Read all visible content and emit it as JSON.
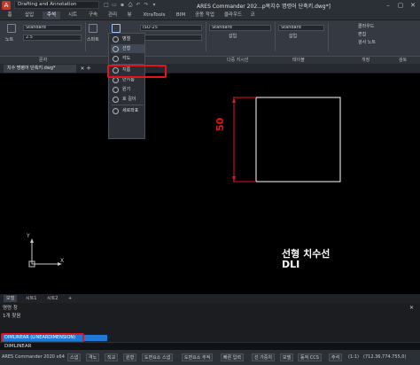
{
  "app": {
    "workspace": "Drafting and Annotation",
    "window_title": "ARES Commander 202...p복치수 명령어 단축키.dwg*]"
  },
  "ribbon_tabs": [
    "홈",
    "삽입",
    "주석",
    "시트",
    "구속",
    "관리",
    "뷰",
    "XtraTools",
    "BIM",
    "공동 작업",
    "클라우드",
    "코"
  ],
  "ribbon": {
    "text_style": "Standard",
    "text_height": "2.5",
    "note_label": "노트",
    "smart_label": "스마트",
    "dim_label": "치수",
    "dim_style": "ISO-25",
    "table_style": "Standard",
    "mleader_style": "Standard",
    "insert_label": "삽입",
    "insert_label2": "삽입",
    "cloud_label": "클라우드",
    "edit_label": "편집",
    "page_note_label": "검사 노트"
  },
  "panel_labels": {
    "text": "문자",
    "mleader": "다중 지시선",
    "table": "테이블",
    "markup": "개정",
    "review": "검토"
  },
  "document_tab": "치수 명령어 단축키.dwg*",
  "dropdown": {
    "items": [
      "병렬",
      "선형",
      "각도",
      "지름",
      "반지름",
      "원기",
      "호 길이",
      "세로좌표"
    ],
    "selected_index": 1
  },
  "drawing": {
    "dim_value": "50",
    "note_title": "선형 치수선",
    "note_command": "DLI",
    "ucs_y": "Y",
    "ucs_x": "X"
  },
  "layout_tabs": [
    "모델",
    "시트1",
    "시트2"
  ],
  "command": {
    "history_label": "명령 창",
    "history_line": "1개 찾음",
    "autocomplete": "DIMLINEAR (LINEARDIMENSION)",
    "input": "DIMLINEAR"
  },
  "status": {
    "app": "ARES Commander 2020 x64",
    "toggles": [
      "스냅",
      "격노",
      "직교",
      "원형",
      "도면요소 스냅",
      "도면요소 추적",
      "빠른 입력",
      "선 가중치",
      "모델",
      "동적 CCS",
      "주석"
    ],
    "scale": "(1:1)",
    "coords": "(712.36,774.755,0)"
  },
  "colors": {
    "accent_red": "#e4141e",
    "dimension_red": "#e4141e",
    "selection_blue": "#1e7ad6"
  }
}
